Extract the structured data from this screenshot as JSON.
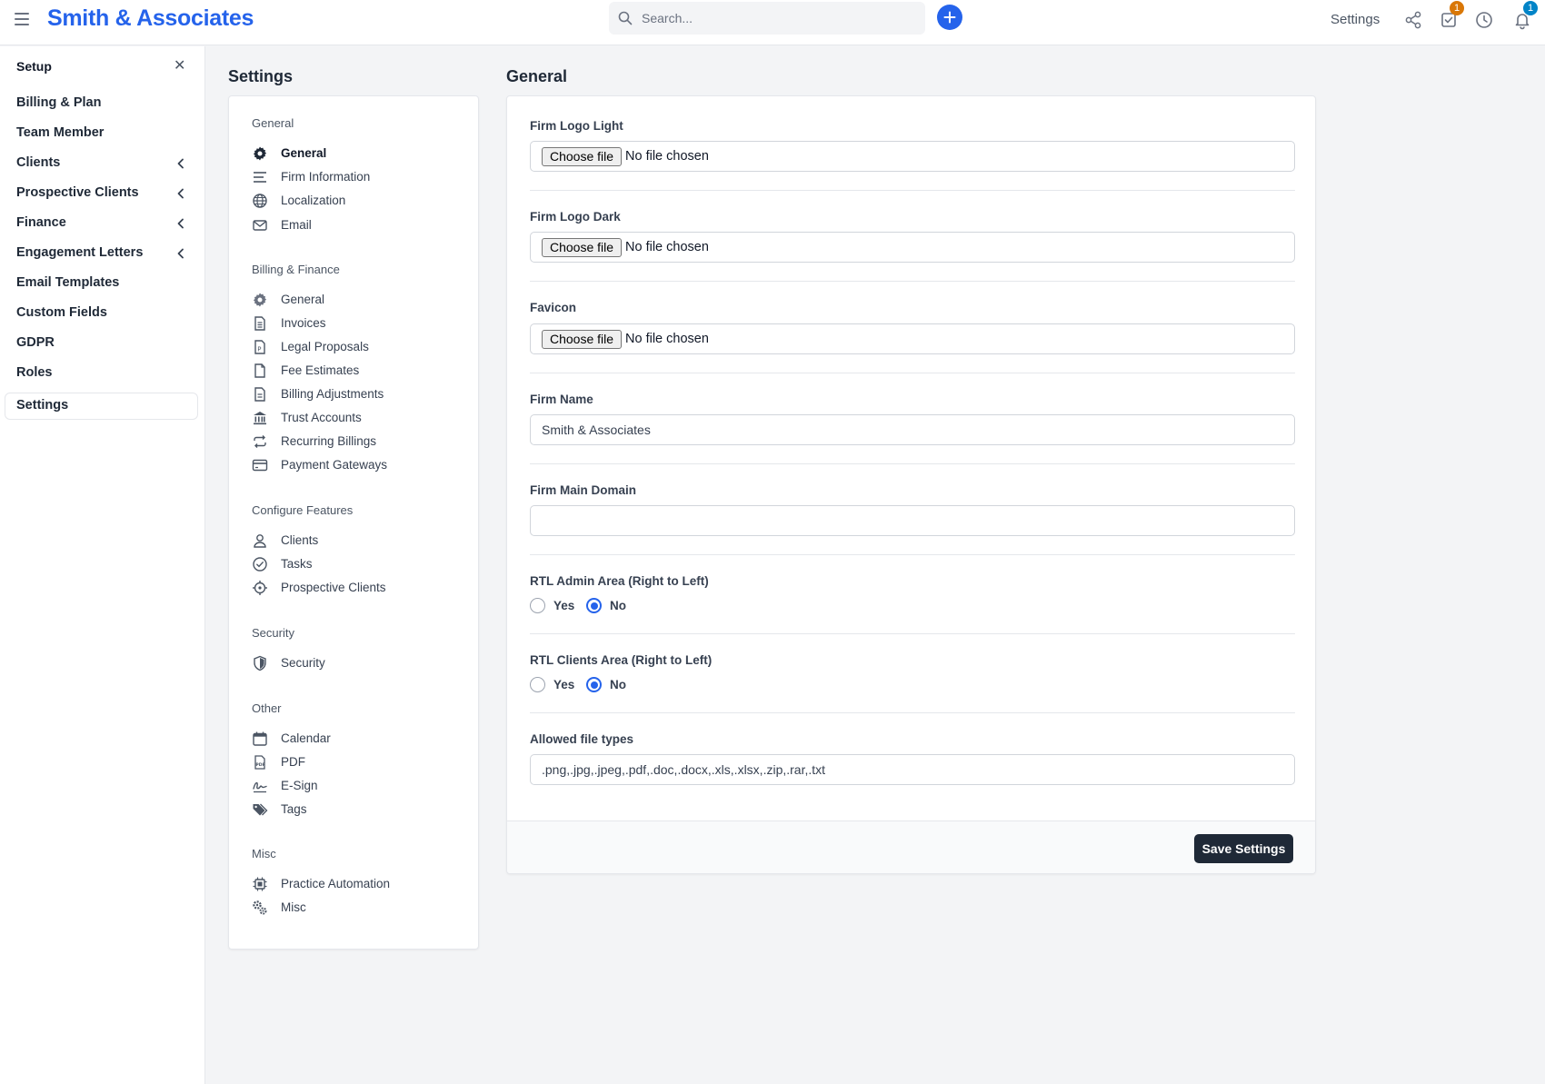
{
  "header": {
    "brand": "Smith & Associates",
    "search_placeholder": "Search...",
    "settings_link": "Settings",
    "tasks_badge": "1",
    "notifications_badge": "1",
    "colors": {
      "brand": "#2563eb",
      "badge_tasks": "#d97706",
      "badge_notifications": "#0284c7"
    }
  },
  "sidebar": {
    "title": "Setup",
    "items": [
      {
        "label": "Billing & Plan"
      },
      {
        "label": "Team Member"
      },
      {
        "label": "Clients"
      },
      {
        "label": "Prospective Clients"
      },
      {
        "label": "Finance"
      },
      {
        "label": "Engagement Letters"
      },
      {
        "label": "Email Templates"
      },
      {
        "label": "Custom Fields"
      },
      {
        "label": "GDPR"
      },
      {
        "label": "Roles"
      },
      {
        "label": "Settings"
      }
    ]
  },
  "settings_menu": {
    "title": "Settings",
    "groups": [
      {
        "title": "General",
        "items": [
          {
            "label": "General",
            "icon": "gear-icon"
          },
          {
            "label": "Firm Information",
            "icon": "lines-icon"
          },
          {
            "label": "Localization",
            "icon": "globe-icon"
          },
          {
            "label": "Email",
            "icon": "envelope-icon"
          }
        ]
      },
      {
        "title": "Billing & Finance",
        "items": [
          {
            "label": "General",
            "icon": "gear-icon"
          },
          {
            "label": "Invoices",
            "icon": "invoice-icon"
          },
          {
            "label": "Legal Proposals",
            "icon": "proposal-icon"
          },
          {
            "label": "Fee Estimates",
            "icon": "document-icon"
          },
          {
            "label": "Billing Adjustments",
            "icon": "document-lines-icon"
          },
          {
            "label": "Trust Accounts",
            "icon": "bank-icon"
          },
          {
            "label": "Recurring Billings",
            "icon": "repeat-icon"
          },
          {
            "label": "Payment Gateways",
            "icon": "credit-card-icon"
          }
        ]
      },
      {
        "title": "Configure Features",
        "items": [
          {
            "label": "Clients",
            "icon": "user-icon"
          },
          {
            "label": "Tasks",
            "icon": "check-circle-icon"
          },
          {
            "label": "Prospective Clients",
            "icon": "crosshair-icon"
          }
        ]
      },
      {
        "title": "Security",
        "items": [
          {
            "label": "Security",
            "icon": "shield-icon"
          }
        ]
      },
      {
        "title": "Other",
        "items": [
          {
            "label": "Calendar",
            "icon": "calendar-icon"
          },
          {
            "label": "PDF",
            "icon": "pdf-icon"
          },
          {
            "label": "E-Sign",
            "icon": "signature-icon"
          },
          {
            "label": "Tags",
            "icon": "tags-icon"
          }
        ]
      },
      {
        "title": "Misc",
        "items": [
          {
            "label": "Practice Automation",
            "icon": "chip-icon"
          },
          {
            "label": "Misc",
            "icon": "gears-icon"
          }
        ]
      }
    ]
  },
  "form": {
    "title": "General",
    "logo_light": {
      "label": "Firm Logo Light",
      "button": "Choose file",
      "status": "No file chosen"
    },
    "logo_dark": {
      "label": "Firm Logo Dark",
      "button": "Choose file",
      "status": "No file chosen"
    },
    "favicon": {
      "label": "Favicon",
      "button": "Choose file",
      "status": "No file chosen"
    },
    "firm_name": {
      "label": "Firm Name",
      "value": "Smith & Associates"
    },
    "main_domain": {
      "label": "Firm Main Domain",
      "value": ""
    },
    "rtl_admin": {
      "label": "RTL Admin Area (Right to Left)",
      "yes": "Yes",
      "no": "No",
      "selected": "No"
    },
    "rtl_clients": {
      "label": "RTL Clients Area (Right to Left)",
      "yes": "Yes",
      "no": "No",
      "selected": "No"
    },
    "allowed_types": {
      "label": "Allowed file types",
      "value": ".png,.jpg,.jpeg,.pdf,.doc,.docx,.xls,.xlsx,.zip,.rar,.txt"
    },
    "save_button": "Save Settings"
  }
}
